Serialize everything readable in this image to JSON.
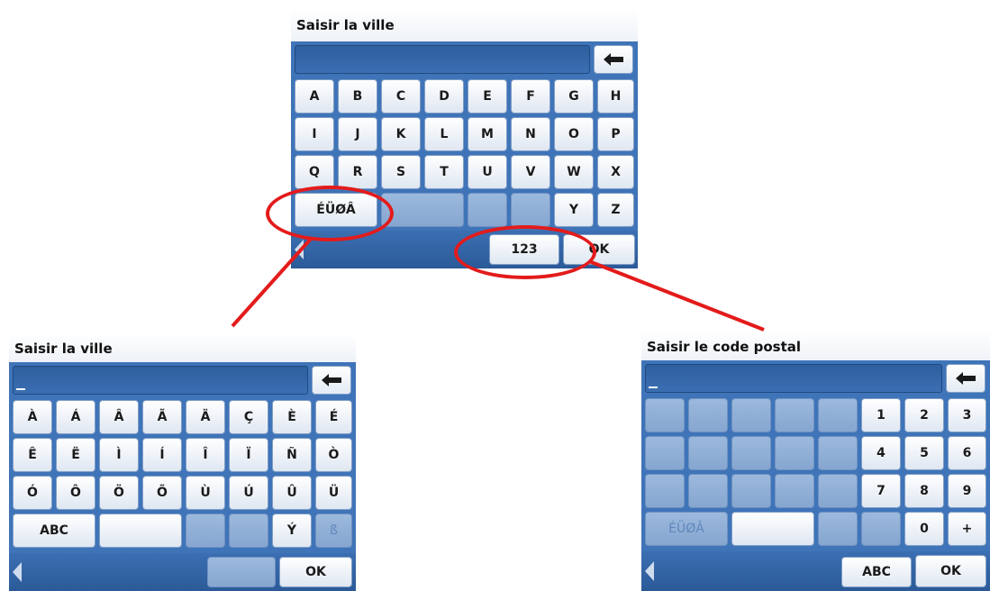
{
  "top_screen": {
    "title": "Saisir la ville",
    "rows": [
      [
        "A",
        "B",
        "C",
        "D",
        "E",
        "F",
        "G",
        "H"
      ],
      [
        "I",
        "J",
        "K",
        "L",
        "M",
        "N",
        "O",
        "P"
      ],
      [
        "Q",
        "R",
        "S",
        "T",
        "U",
        "V",
        "W",
        "X"
      ]
    ],
    "row4_special": "ÉÜØÂ",
    "row4_keys": [
      "Y",
      "Z"
    ],
    "bottom_keys": {
      "numeric": "123",
      "ok": "OK"
    }
  },
  "accent_screen": {
    "title": "Saisir la ville",
    "rows": [
      [
        "À",
        "Á",
        "Â",
        "Ã",
        "Ä",
        "Ç",
        "È",
        "É"
      ],
      [
        "Ê",
        "Ë",
        "Ì",
        "Í",
        "Î",
        "Ï",
        "Ñ",
        "Ò"
      ],
      [
        "Ó",
        "Ô",
        "Ö",
        "Õ",
        "Ù",
        "Ú",
        "Û",
        "Ü"
      ]
    ],
    "row4": {
      "abc": "ABC",
      "y_acute": "Ý",
      "eszett": "ß"
    },
    "bottom_keys": {
      "ok": "OK"
    }
  },
  "numeric_screen": {
    "title": "Saisir le code postal",
    "rows": [
      [
        "1",
        "2",
        "3"
      ],
      [
        "4",
        "5",
        "6"
      ],
      [
        "7",
        "8",
        "9"
      ]
    ],
    "row4": {
      "special": "ÉÜØÂ",
      "zero": "0",
      "plus": "+"
    },
    "bottom_keys": {
      "abc": "ABC",
      "ok": "OK"
    }
  },
  "icons": {
    "backspace": "left-arrow-icon",
    "back_nav": "back-triangle-icon"
  },
  "colors": {
    "screen_bg": "#3f74b8",
    "key_bg": "#ffffff",
    "highlight": "#e31b1b"
  }
}
